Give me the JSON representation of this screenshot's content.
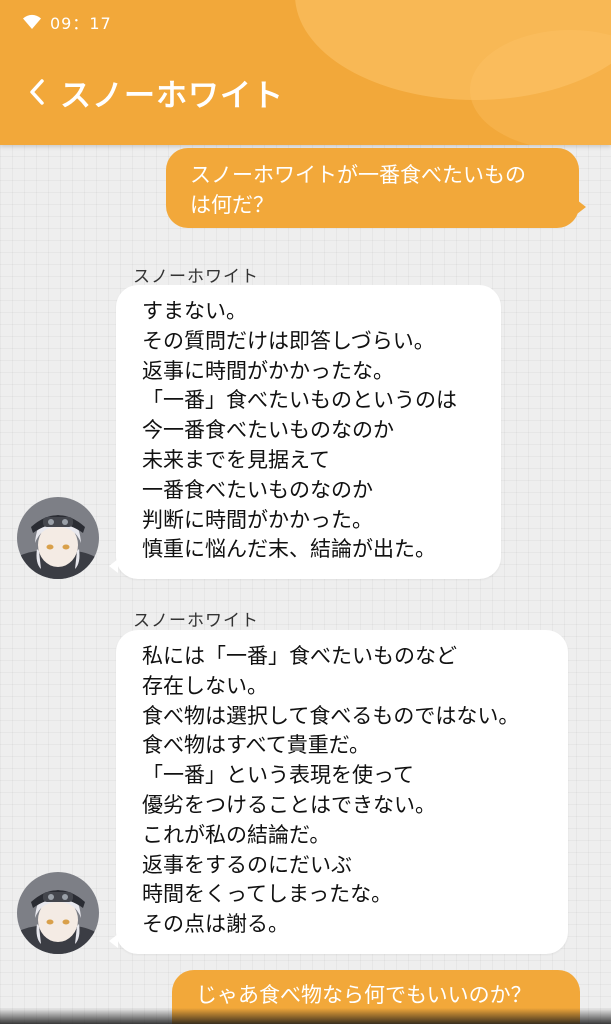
{
  "status_bar": {
    "time": "09：17",
    "wifi_icon": "wifi-icon"
  },
  "header": {
    "back_icon": "chevron-left-icon",
    "title": "スノーホワイト"
  },
  "colors": {
    "accent": "#f2a83a",
    "incoming_bubble": "#ffffff",
    "background": "#eeeeee"
  },
  "messages": [
    {
      "direction": "outgoing",
      "lines": [
        "スノーホワイトが一番食べたいもの",
        "は何だ？"
      ]
    },
    {
      "direction": "incoming",
      "sender": "スノーホワイト",
      "lines": [
        "すまない。",
        "その質問だけは即答しづらい。",
        "返事に時間がかかったな。",
        "「一番」食べたいものというのは",
        "今一番食べたいものなのか",
        "未来までを見据えて",
        "一番食べたいものなのか",
        "判断に時間がかかった。",
        "慎重に悩んだ末、結論が出た。"
      ]
    },
    {
      "direction": "incoming",
      "sender": "スノーホワイト",
      "lines": [
        "私には「一番」食べたいものなど",
        "存在しない。",
        "食べ物は選択して食べるものではない。",
        "食べ物はすべて貴重だ。",
        "「一番」という表現を使って",
        "優劣をつけることはできない。",
        "これが私の結論だ。",
        "返事をするのにだいぶ",
        "時間をくってしまったな。",
        "その点は謝る。"
      ]
    },
    {
      "direction": "outgoing",
      "lines": [
        "じゃあ食べ物なら何でもいいのか？"
      ]
    }
  ]
}
